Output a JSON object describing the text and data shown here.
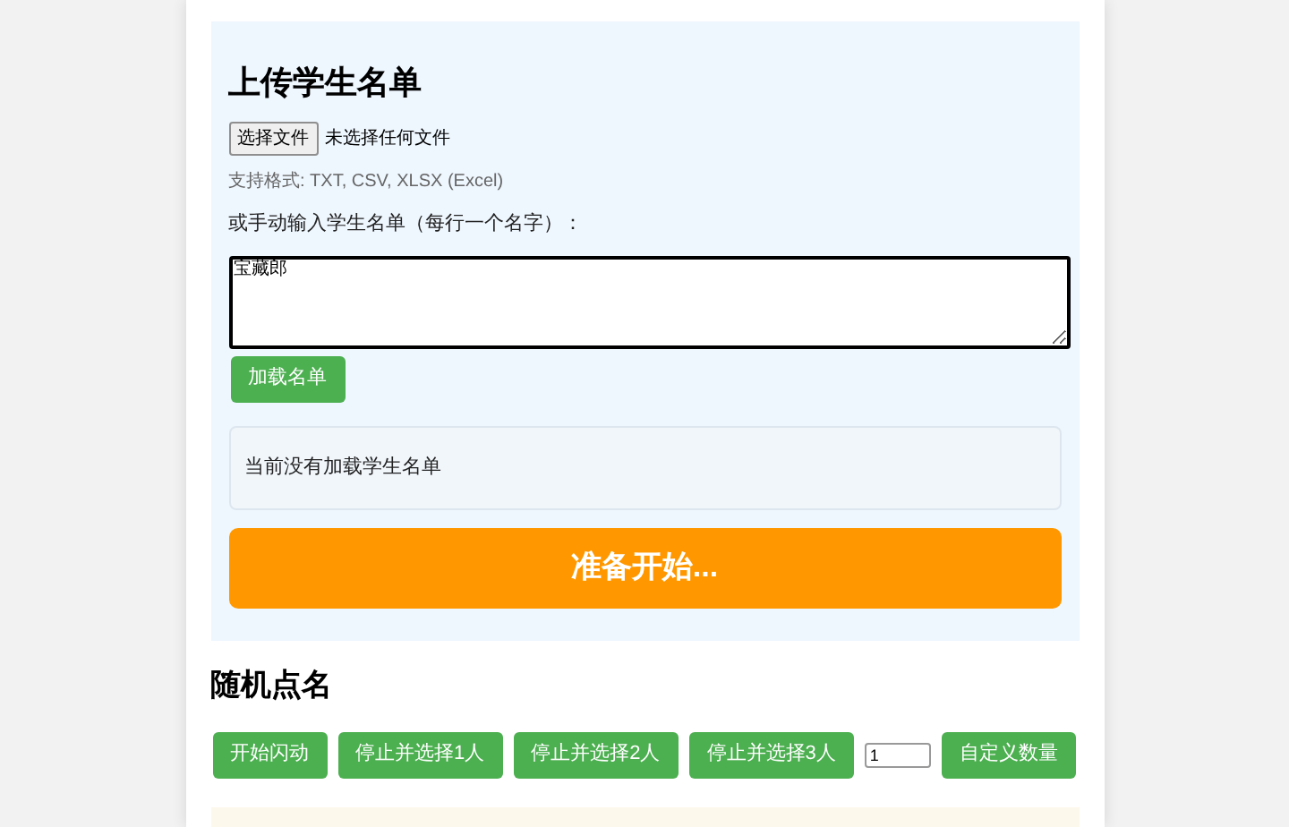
{
  "upload_section": {
    "title": "上传学生名单",
    "file_button": "选择文件",
    "file_status": "未选择任何文件",
    "formats_hint": "支持格式: TXT, CSV, XLSX (Excel)",
    "manual_label": "或手动输入学生名单（每行一个名字）：",
    "textarea_value": "宝藏郎",
    "load_button": "加载名单",
    "list_status": "当前没有加载学生名单",
    "display": "准备开始..."
  },
  "roll_call": {
    "title": "随机点名",
    "controls": [
      {
        "kind": "button",
        "label": "开始闪动"
      },
      {
        "kind": "button",
        "label": "停止并选择1人"
      },
      {
        "kind": "button",
        "label": "停止并选择2人"
      },
      {
        "kind": "button",
        "label": "停止并选择3人"
      },
      {
        "kind": "number",
        "value": "1"
      },
      {
        "kind": "button",
        "label": "自定义数量"
      }
    ]
  }
}
